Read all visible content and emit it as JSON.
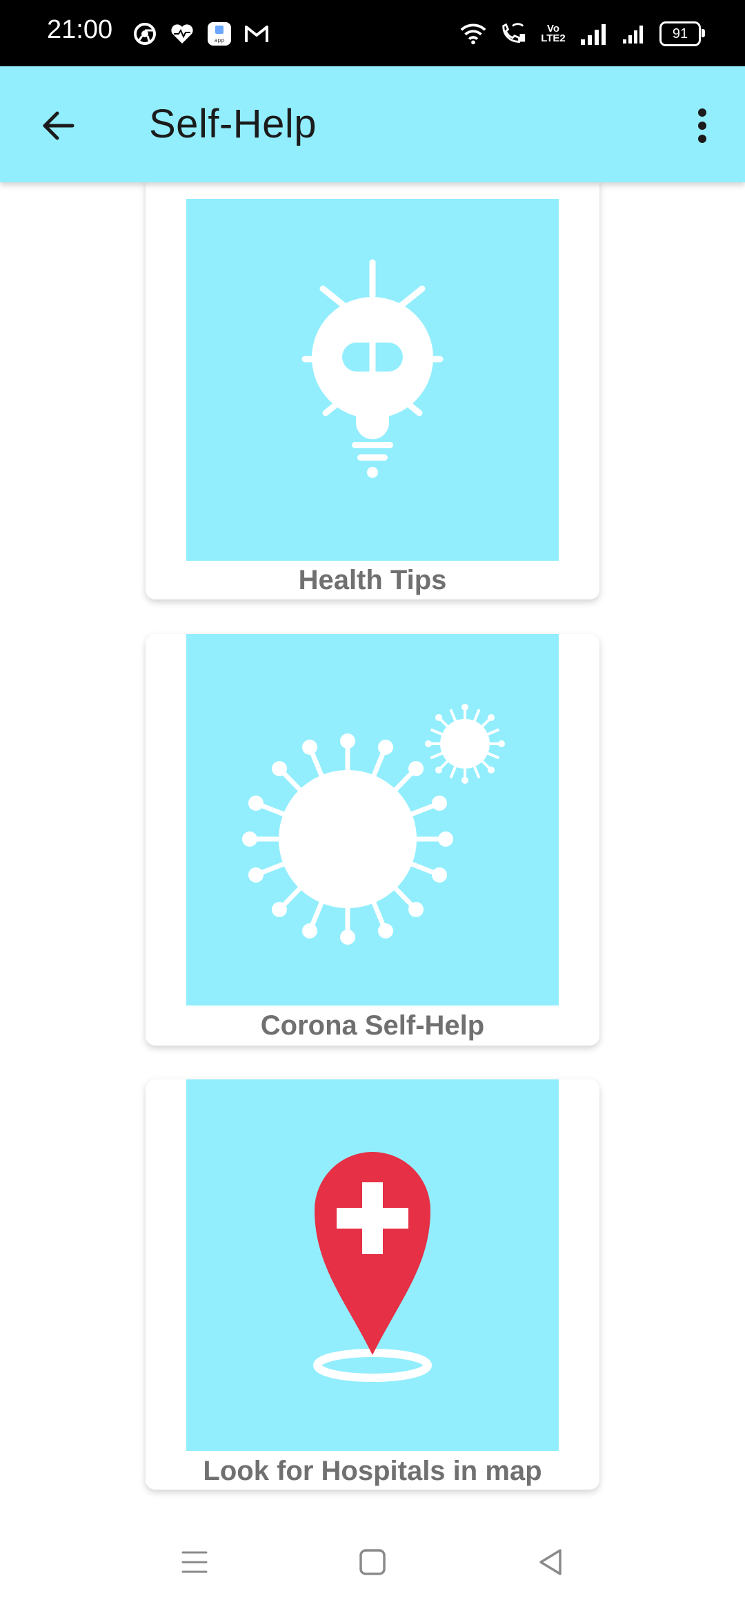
{
  "status_bar": {
    "time": "21:00",
    "battery": "91",
    "network_label": "Vo LTE2",
    "left_icons": [
      "chrome-icon",
      "heart-icon",
      "app-icon",
      "gmail-icon"
    ],
    "right_icons": [
      "wifi-icon",
      "wifi-calling-icon",
      "volte-icon",
      "signal-icon",
      "signal-icon-2",
      "battery-icon"
    ]
  },
  "app_bar": {
    "title": "Self-Help",
    "background": "#92eefd"
  },
  "cards": [
    {
      "label": "Health Tips",
      "icon": "lightbulb-icon"
    },
    {
      "label": "Corona Self-Help",
      "icon": "virus-icon"
    },
    {
      "label": "Look for Hospitals in map",
      "icon": "hospital-pin-icon"
    }
  ],
  "colors": {
    "accent": "#92eefd",
    "pin_red": "#e53045",
    "label_gray": "#707070"
  },
  "nav_bar": {
    "buttons": [
      "menu-icon",
      "home-icon",
      "back-icon"
    ]
  }
}
